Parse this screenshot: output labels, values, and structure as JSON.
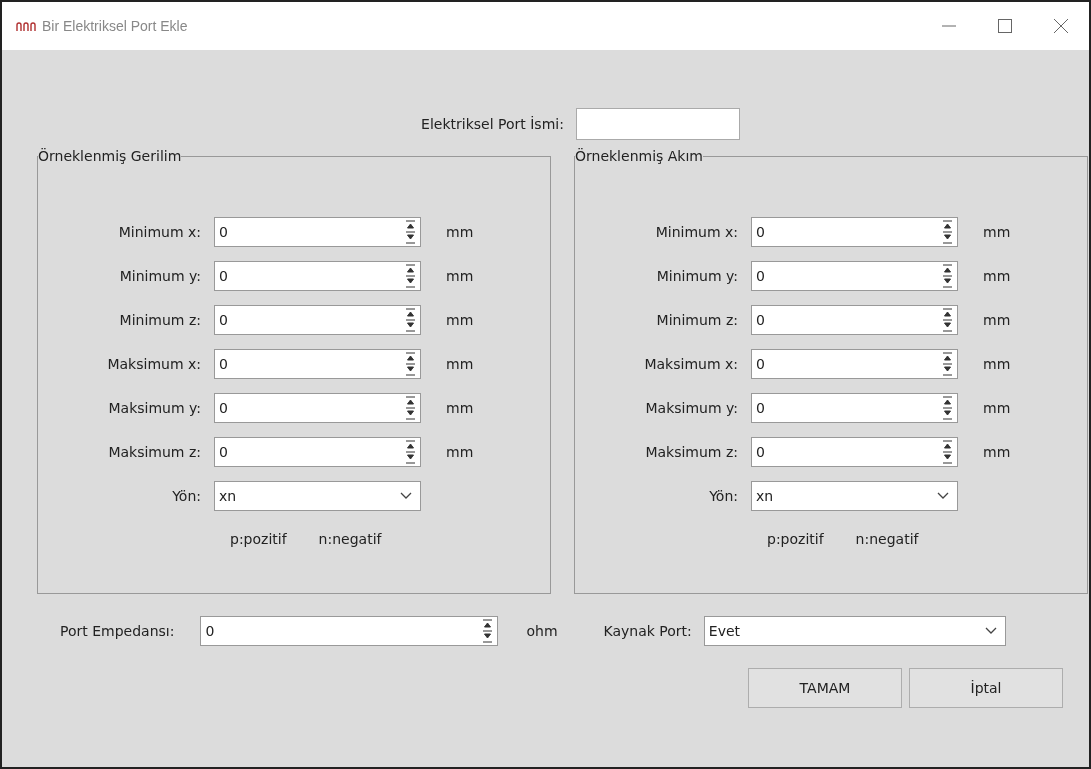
{
  "window": {
    "title": "Bir Elektriksel Port Ekle"
  },
  "port_name": {
    "label": "Elektriksel Port İsmi:"
  },
  "groups": [
    {
      "title": "Örneklenmiş Gerilim",
      "fields": [
        {
          "label": "Minimum x:",
          "value": "0",
          "unit": "mm"
        },
        {
          "label": "Minimum y:",
          "value": "0",
          "unit": "mm"
        },
        {
          "label": "Minimum z:",
          "value": "0",
          "unit": "mm"
        },
        {
          "label": "Maksimum x:",
          "value": "0",
          "unit": "mm"
        },
        {
          "label": "Maksimum y:",
          "value": "0",
          "unit": "mm"
        },
        {
          "label": "Maksimum z:",
          "value": "0",
          "unit": "mm"
        }
      ],
      "direction": {
        "label": "Yön:",
        "value": "xn"
      },
      "legend": [
        "p:pozitif",
        "n:negatif"
      ]
    },
    {
      "title": "Örneklenmiş Akım",
      "fields": [
        {
          "label": "Minimum x:",
          "value": "0",
          "unit": "mm"
        },
        {
          "label": "Minimum y:",
          "value": "0",
          "unit": "mm"
        },
        {
          "label": "Minimum z:",
          "value": "0",
          "unit": "mm"
        },
        {
          "label": "Maksimum x:",
          "value": "0",
          "unit": "mm"
        },
        {
          "label": "Maksimum y:",
          "value": "0",
          "unit": "mm"
        },
        {
          "label": "Maksimum z:",
          "value": "0",
          "unit": "mm"
        }
      ],
      "direction": {
        "label": "Yön:",
        "value": "xn"
      },
      "legend": [
        "p:pozitif",
        "n:negatif"
      ]
    }
  ],
  "impedance": {
    "label": "Port Empedansı:",
    "value": "0",
    "unit": "ohm"
  },
  "source_port": {
    "label": "Kaynak Port:",
    "value": "Evet"
  },
  "buttons": [
    "TAMAM",
    "İptal"
  ]
}
